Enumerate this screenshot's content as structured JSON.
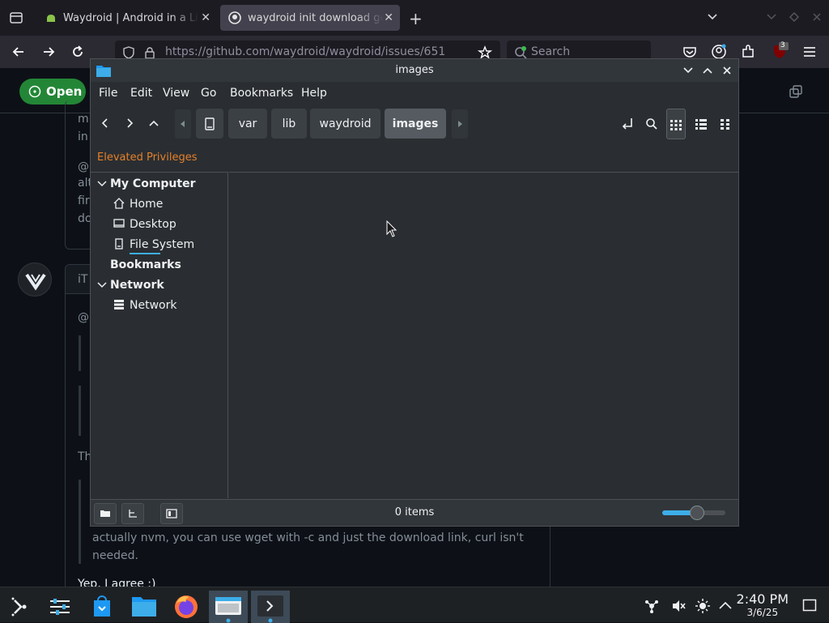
{
  "browser": {
    "tabs": [
      {
        "title": "Waydroid | Android in a Li",
        "active": false
      },
      {
        "title": "waydroid init download ge",
        "active": true
      }
    ],
    "url": "https://github.com/waydroid/waydroid/issues/651",
    "search_placeholder": "Search",
    "ublock_badge": "3"
  },
  "github": {
    "status_badge": "Open",
    "visible_fragments": {
      "f1": "m",
      "f2": "in",
      "f3": "@",
      "f4": "alt",
      "f5": "fir",
      "f6": "do",
      "f7": "iT",
      "f8": "@",
      "f9": "Th"
    },
    "comment_line1": "actually nvm, you can use wget with -c and just the download link, curl isn't",
    "comment_line2": "needed.",
    "reply": "Yep, I agree :)"
  },
  "file_manager": {
    "window_title": "images",
    "menu": [
      "File",
      "Edit",
      "View",
      "Go",
      "Bookmarks",
      "Help"
    ],
    "breadcrumbs": [
      "var",
      "lib",
      "waydroid",
      "images"
    ],
    "elevated_label": "Elevated Privileges",
    "sidebar": {
      "my_computer": "My Computer",
      "home": "Home",
      "desktop": "Desktop",
      "file_system": "File System",
      "bookmarks": "Bookmarks",
      "network_section": "Network",
      "network_item": "Network"
    },
    "status_text": "0 items",
    "zoom_level": 0.55
  },
  "taskbar": {
    "time": "2:40 PM",
    "date": "3/6/25"
  },
  "colors": {
    "accent": "#3daee9",
    "elevated": "#e5802a",
    "github_open": "#238636"
  }
}
